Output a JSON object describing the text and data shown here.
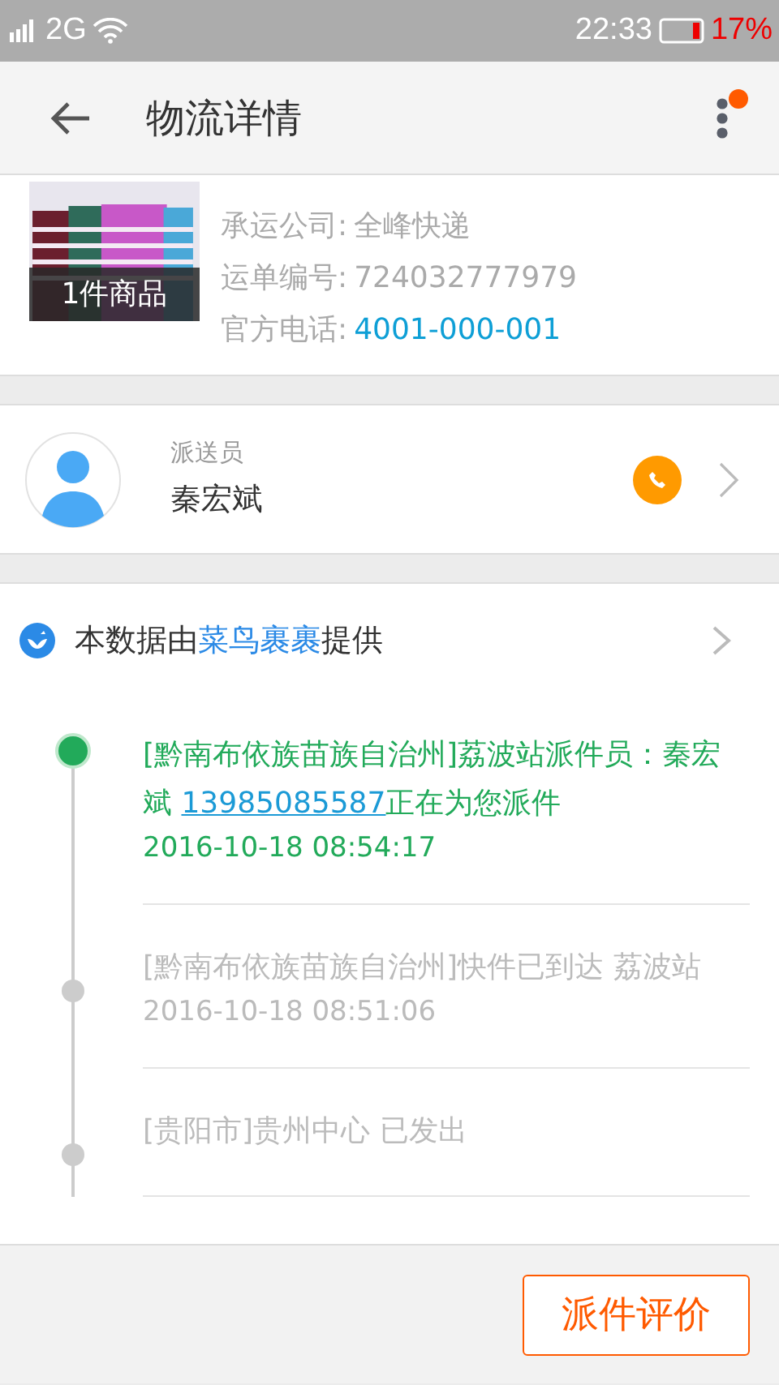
{
  "status_bar": {
    "network": "2G",
    "time": "22:33",
    "battery": "17%"
  },
  "header": {
    "title": "物流详情",
    "notification_dot": true
  },
  "package": {
    "image_caption": "1件商品",
    "details": [
      {
        "label": "承运公司:",
        "value": "全峰快递",
        "kind": "plain"
      },
      {
        "label": "运单编号:",
        "value": "724032777979",
        "kind": "plain"
      },
      {
        "label": "官方电话:",
        "value": "4001-000-001",
        "kind": "link"
      }
    ]
  },
  "courier": {
    "role": "派送员",
    "name": "秦宏斌"
  },
  "source": {
    "prefix": "本数据由",
    "provider": "菜鸟裹裹",
    "suffix": "提供"
  },
  "timeline": [
    {
      "text": "[黔南布依族苗族自治州]荔波站派件员：秦宏斌 ",
      "phone": "13985085587",
      "text_after": "正在为您派件",
      "time": "2016-10-18 08:54:17",
      "current": true
    },
    {
      "text": "[黔南布依族苗族自治州]快件已到达 荔波站",
      "time": "2016-10-18 08:51:06",
      "current": false
    },
    {
      "text": "[贵阳市]贵州中心 已发出",
      "current": false
    }
  ],
  "footer": {
    "button": "派件评价"
  }
}
